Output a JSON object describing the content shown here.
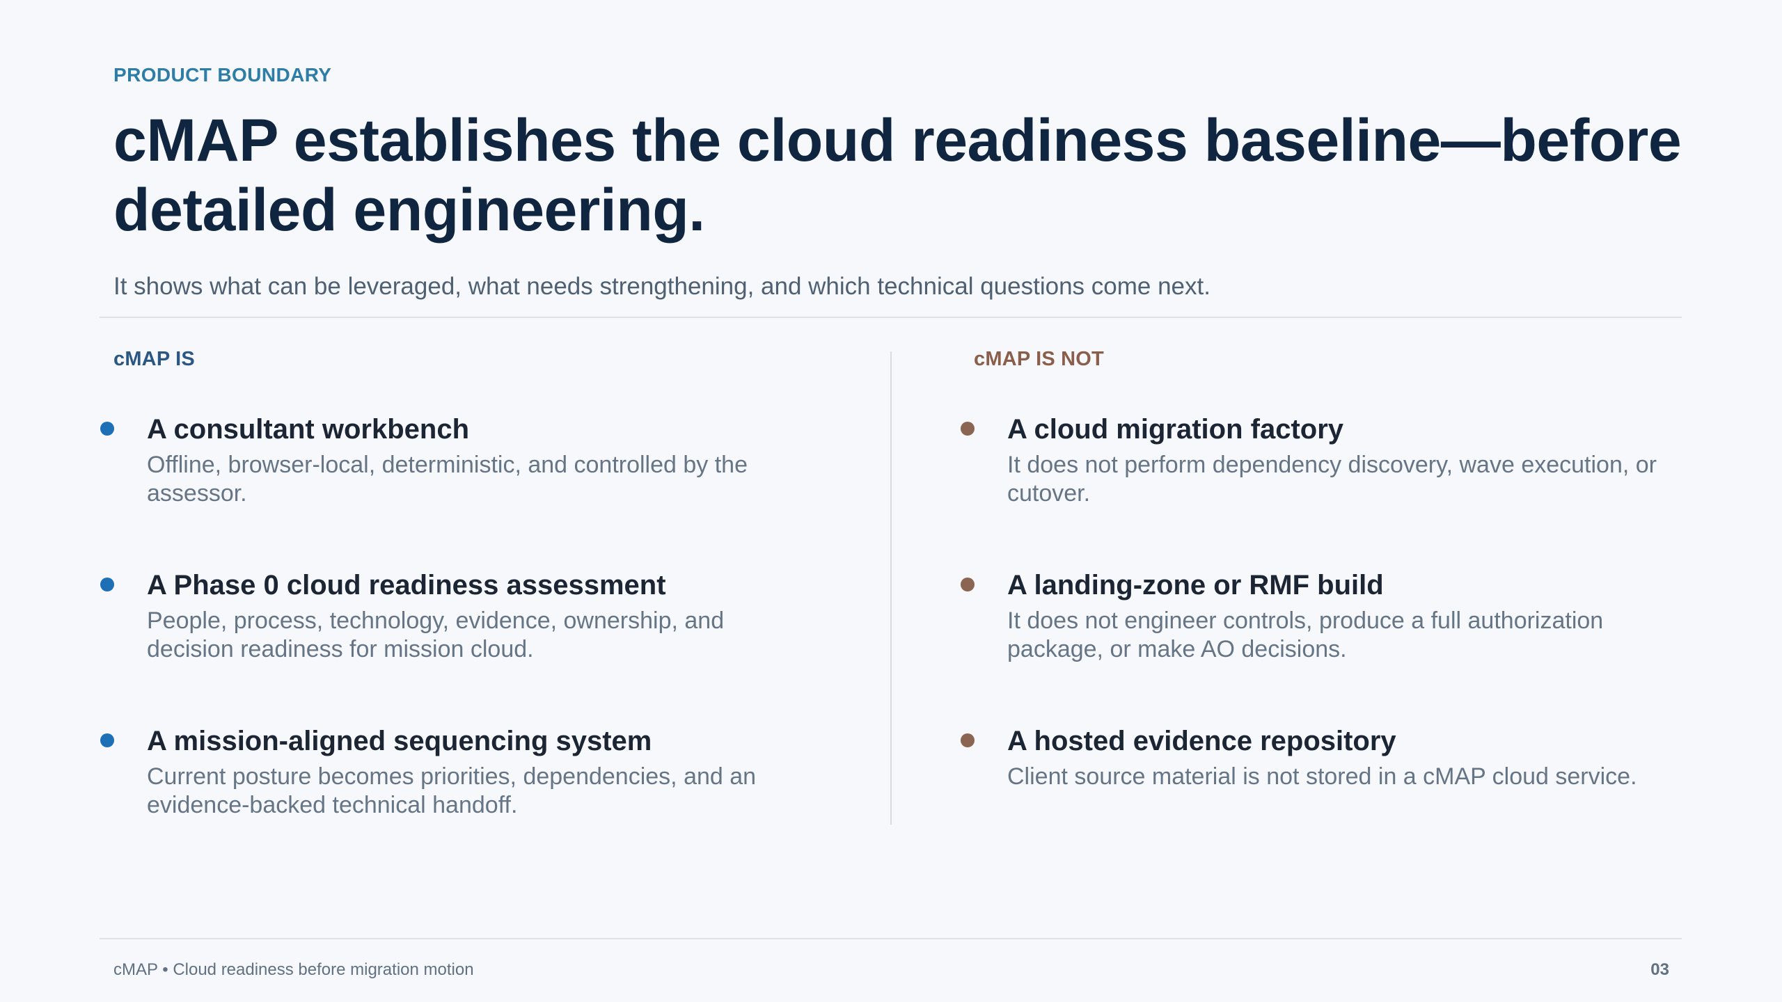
{
  "eyebrow": "PRODUCT BOUNDARY",
  "headline": "cMAP establishes the cloud readiness baseline—before detailed engineering.",
  "subhead": "It shows what can be leveraged, what needs strengthening, and which technical questions come next.",
  "is_column": {
    "heading": "cMAP IS",
    "items": [
      {
        "title": "A consultant workbench",
        "desc": "Offline, browser-local, deterministic, and controlled by the assessor."
      },
      {
        "title": "A Phase 0 cloud readiness assessment",
        "desc": "People, process, technology, evidence, ownership, and decision readiness for mission cloud."
      },
      {
        "title": "A mission-aligned sequencing system",
        "desc": "Current posture becomes priorities, dependencies, and an evidence-backed technical handoff."
      }
    ]
  },
  "is_not_column": {
    "heading": "cMAP IS NOT",
    "items": [
      {
        "title": "A cloud migration factory",
        "desc": "It does not perform dependency discovery, wave execution, or cutover."
      },
      {
        "title": "A landing-zone or RMF build",
        "desc": "It does not engineer controls, produce a full authorization package, or make AO decisions."
      },
      {
        "title": "A hosted evidence repository",
        "desc": "Client source material is not stored in a cMAP cloud service."
      }
    ]
  },
  "footer": {
    "left": "cMAP • Cloud readiness before migration motion",
    "page_number": "03"
  },
  "colors": {
    "eyebrow": "#2e7da6",
    "is_accent": "#1f6fb7",
    "is_not_accent": "#8c6552",
    "headline": "#10253f"
  }
}
